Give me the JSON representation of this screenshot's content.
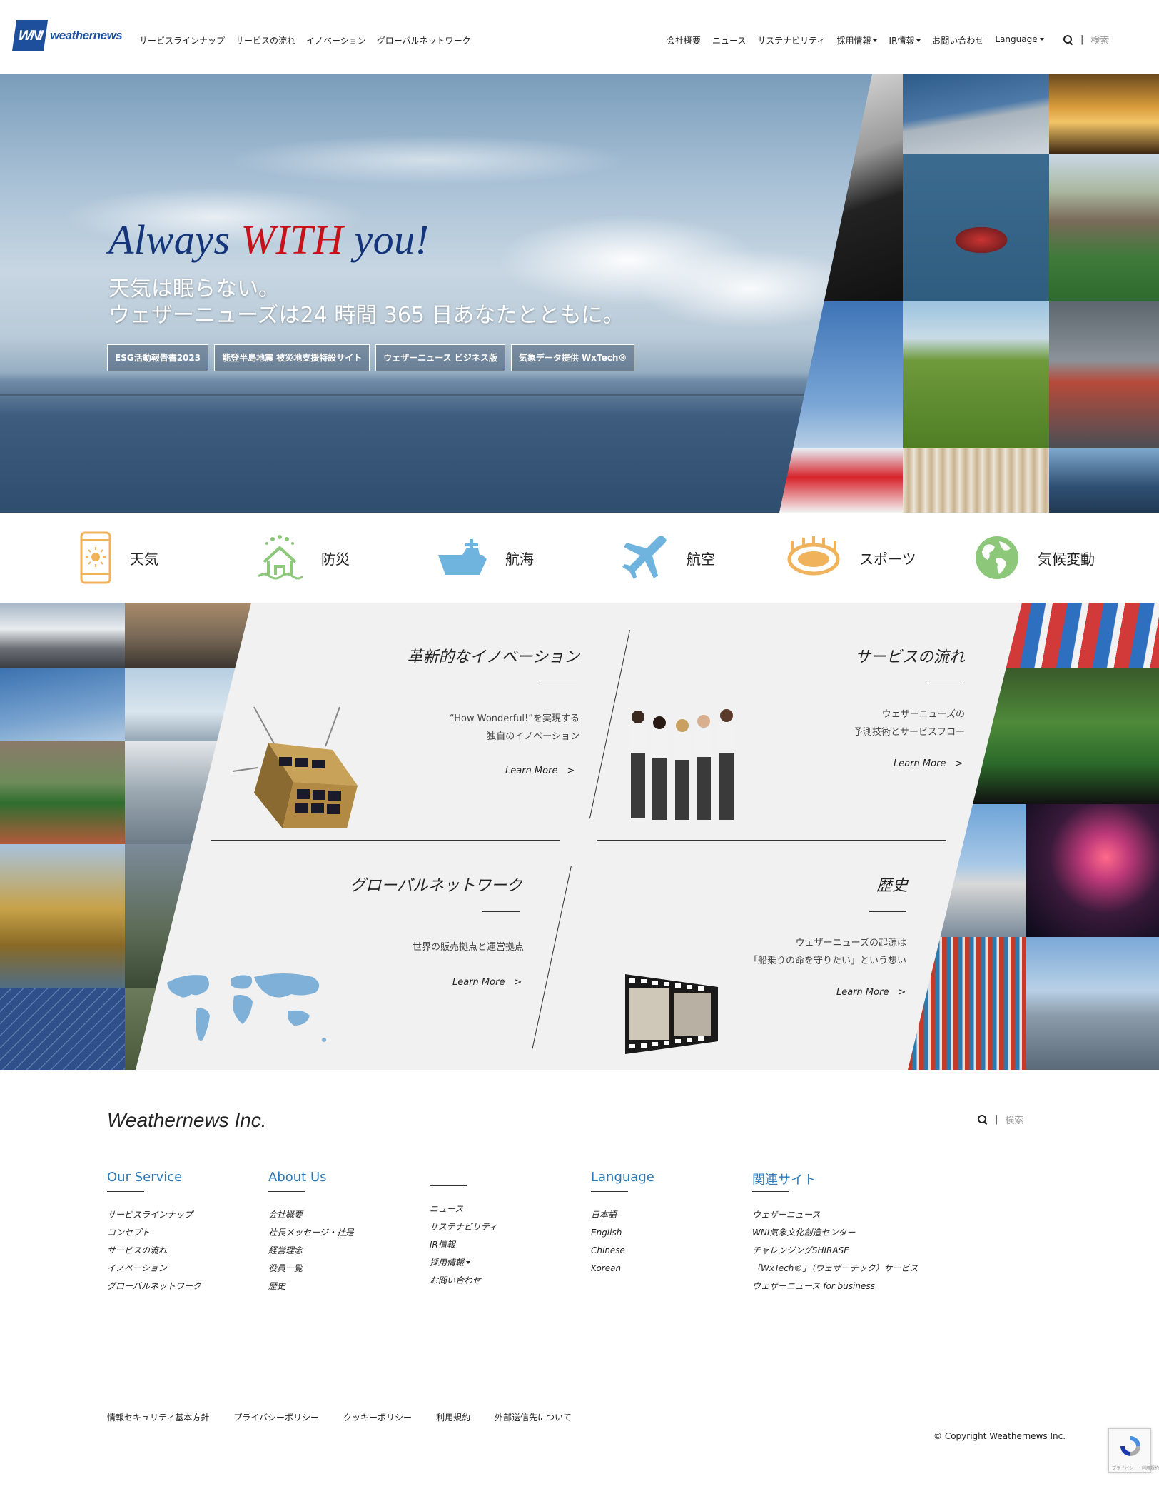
{
  "header": {
    "logo_mark": "WNI",
    "logo_text": "weathernews",
    "nav_left": [
      "サービスラインナップ",
      "サービスの流れ",
      "イノベーション",
      "グローバルネットワーク"
    ],
    "nav_right": [
      {
        "label": "会社概要",
        "dropdown": false
      },
      {
        "label": "ニュース",
        "dropdown": false
      },
      {
        "label": "サステナビリティ",
        "dropdown": false
      },
      {
        "label": "採用情報",
        "dropdown": true
      },
      {
        "label": "IR情報",
        "dropdown": true
      },
      {
        "label": "お問い合わせ",
        "dropdown": false
      },
      {
        "label": "Language",
        "dropdown": true
      }
    ],
    "search_placeholder": "検索"
  },
  "hero": {
    "title_a": "Always ",
    "title_b": "WITH",
    "title_c": " you!",
    "subtitle_1": "天気は眠らない。",
    "subtitle_2": "ウェザーニューズは24 時間 365 日あなたとともに。",
    "buttons": [
      "ESG活動報告書2023",
      "能登半島地震 被災地支援特設サイト",
      "ウェザーニュース ビジネス版",
      "気象データ提供 WxTech®"
    ]
  },
  "categories": [
    {
      "label": "天気",
      "icon": "smartphone-sun-icon"
    },
    {
      "label": "防災",
      "icon": "house-flood-icon"
    },
    {
      "label": "航海",
      "icon": "ship-icon"
    },
    {
      "label": "航空",
      "icon": "airplane-icon"
    },
    {
      "label": "スポーツ",
      "icon": "stadium-icon"
    },
    {
      "label": "気候変動",
      "icon": "globe-icon"
    }
  ],
  "panels": {
    "innovation": {
      "title": "革新的なイノベーション",
      "text_1": "“How Wonderful!”を実現する",
      "text_2": "独自のイノベーション",
      "link": "Learn More　>"
    },
    "service_flow": {
      "title": "サービスの流れ",
      "text_1": "ウェザーニューズの",
      "text_2": "予測技術とサービスフロー",
      "link": "Learn More　>"
    },
    "global": {
      "title": "グローバルネットワーク",
      "text_1": "世界の販売拠点と運営拠点",
      "link": "Learn More　>"
    },
    "history": {
      "title": "歴史",
      "text_1": "ウェザーニューズの起源は",
      "text_2": "「船乗りの命を守りたい」という想い",
      "link": "Learn More　>"
    }
  },
  "footer": {
    "brand": "Weathernews Inc.",
    "search_placeholder": "検索",
    "columns": [
      {
        "heading": "Our Service",
        "items": [
          "サービスラインナップ",
          "コンセプト",
          "サービスの流れ",
          "イノベーション",
          "グローバルネットワーク"
        ]
      },
      {
        "heading": "About Us",
        "items": [
          "会社概要",
          "社長メッセージ・社是",
          "経営理念",
          "役員一覧",
          "歴史"
        ]
      },
      {
        "heading": "",
        "items": [
          "ニュース",
          "サステナビリティ",
          "IR情報",
          "採用情報",
          "お問い合わせ"
        ]
      },
      {
        "heading": "Language",
        "items": [
          "日本語",
          "English",
          "Chinese",
          "Korean"
        ]
      },
      {
        "heading": "関連サイト",
        "items": [
          "ウェザーニュース",
          "WNI気象文化創造センター",
          "チャレンジングSHIRASE",
          "「WxTech®」（ウェザーテック）サービス",
          "ウェザーニュース for business"
        ]
      }
    ],
    "legal": [
      "情報セキュリティ基本方針",
      "プライバシーポリシー",
      "クッキーポリシー",
      "利用規約",
      "外部送信先について"
    ],
    "copyright": "© Copyright Weathernews Inc.",
    "recaptcha": "プライバシー・利用規約"
  },
  "colors": {
    "brand_blue": "#1d4f9c",
    "accent_red": "#c8121a",
    "link_blue": "#2d7ab8",
    "icon_orange": "#f0b25a",
    "icon_green": "#8cc77a",
    "icon_blue": "#6fb3df"
  }
}
